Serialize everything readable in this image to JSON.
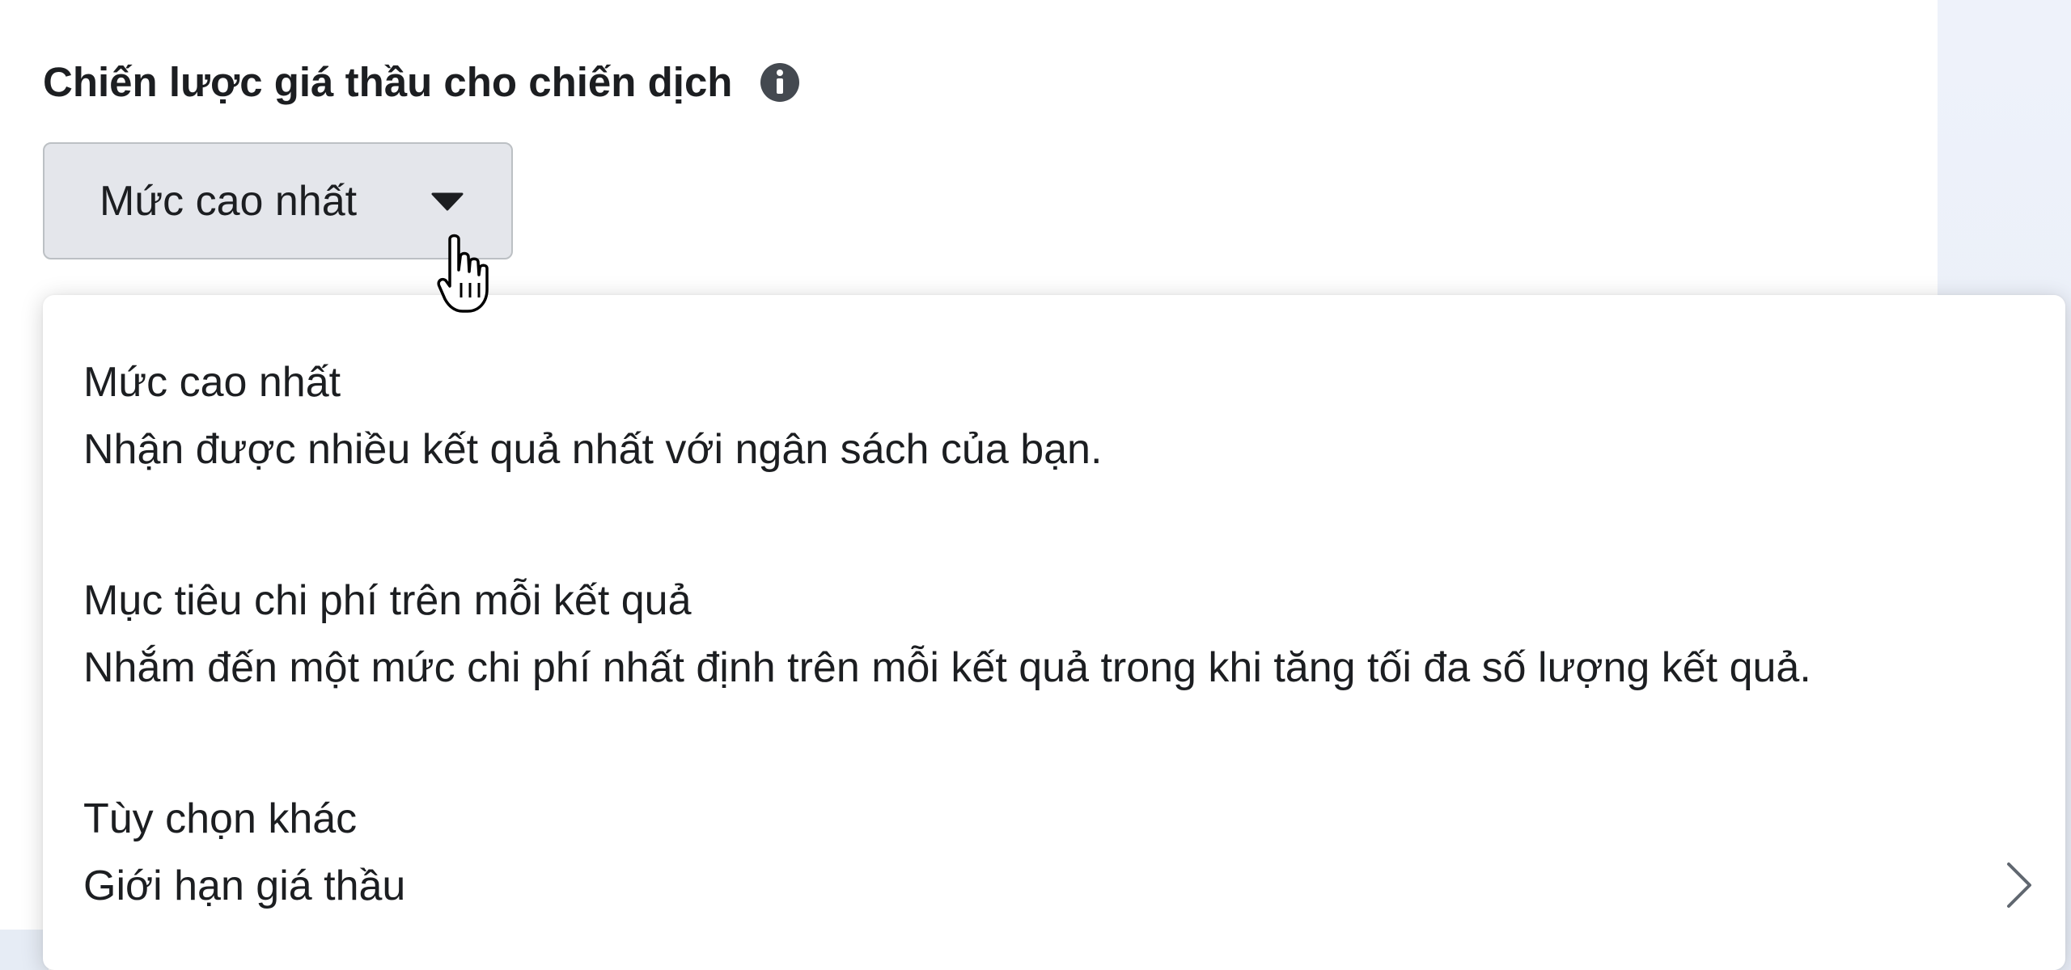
{
  "section": {
    "title": "Chiến lược giá thầu cho chiến dịch",
    "info_icon": "info-icon"
  },
  "dropdown": {
    "selected": "Mức cao nhất",
    "caret_icon": "caret-down-icon",
    "cursor_icon": "hand-pointer-icon"
  },
  "menu": {
    "items": [
      {
        "title": "Mức cao nhất",
        "description": "Nhận được nhiều kết quả nhất với ngân sách của bạn."
      },
      {
        "title": "Mục tiêu chi phí trên mỗi kết quả",
        "description": "Nhắm đến một mức chi phí nhất định trên mỗi kết quả trong khi tăng tối đa số lượng kết quả."
      },
      {
        "title": "Tùy chọn khác",
        "description": "Giới hạn giá thầu",
        "icon": "chevron-right-icon"
      }
    ]
  },
  "colors": {
    "text": "#1c1e21",
    "button_bg": "#e4e6eb",
    "button_border": "#bcc0c4",
    "icon_gray": "#444950"
  }
}
